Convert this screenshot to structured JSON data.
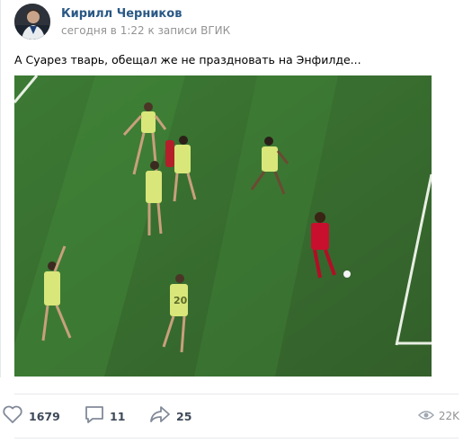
{
  "post": {
    "author": "Кирилл Черников",
    "meta": "сегодня в 1:22 к записи ВГИК",
    "text": "А Суарез тварь, обещал же не праздновать на Энфилде..."
  },
  "actions": {
    "likes": "1679",
    "comments": "11",
    "shares": "25",
    "views": "22K"
  },
  "colors": {
    "author_link": "#2a5885",
    "meta_gray": "#939393",
    "pitch_green": "#3a7330",
    "barca_kit": "#d9e67a",
    "liverpool_kit": "#c8102e"
  },
  "icons": {
    "like": "heart-icon",
    "comment": "comment-icon",
    "share": "share-arrow-icon",
    "views": "eye-icon"
  }
}
